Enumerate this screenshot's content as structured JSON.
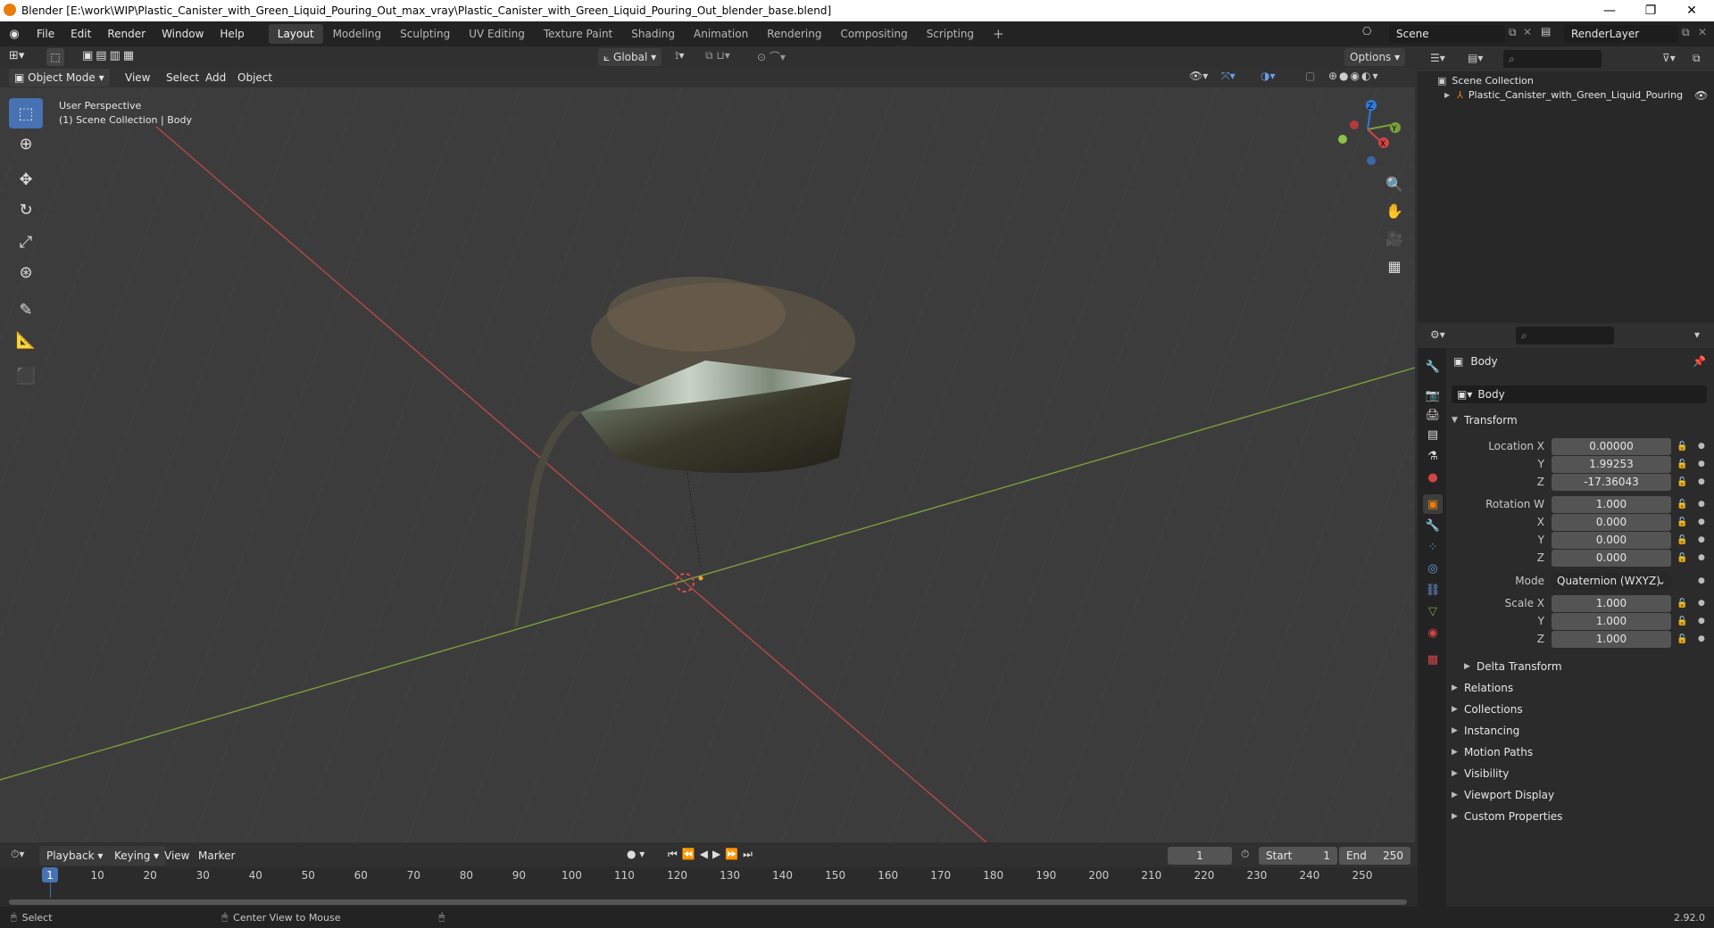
{
  "window": {
    "title": "Blender [E:\\work\\WIP\\Plastic_Canister_with_Green_Liquid_Pouring_Out_max_vray\\Plastic_Canister_with_Green_Liquid_Pouring_Out_blender_base.blend]",
    "minimize": "—",
    "restore": "❐",
    "close": "✕"
  },
  "menu": [
    "File",
    "Edit",
    "Render",
    "Window",
    "Help"
  ],
  "workspaces": [
    "Layout",
    "Modeling",
    "Sculpting",
    "UV Editing",
    "Texture Paint",
    "Shading",
    "Animation",
    "Rendering",
    "Compositing",
    "Scripting"
  ],
  "active_workspace": "Layout",
  "add_workspace": "+",
  "scene": {
    "label": "Scene",
    "render_layer": "RenderLayer"
  },
  "viewport": {
    "mode": "Object Mode",
    "menus": [
      "View",
      "Select",
      "Add",
      "Object"
    ],
    "transform_orientation": "Global",
    "options": "Options",
    "overlay_line1": "User Perspective",
    "overlay_line2": "(1) Scene Collection | Body",
    "gizmo": {
      "x": "X",
      "y": "Y",
      "z": "Z"
    }
  },
  "outliner": {
    "root": "Scene Collection",
    "items": [
      "Plastic_Canister_with_Green_Liquid_Pouring"
    ]
  },
  "properties": {
    "object_name": "Body",
    "datablock": "Body",
    "transform_label": "Transform",
    "location": {
      "label_x": "Location X",
      "label_y": "Y",
      "label_z": "Z",
      "x": "0.00000",
      "y": "1.99253",
      "z": "-17.36043"
    },
    "rotation": {
      "label_w": "Rotation W",
      "label_x": "X",
      "label_y": "Y",
      "label_z": "Z",
      "w": "1.000",
      "x": "0.000",
      "y": "0.000",
      "z": "0.000"
    },
    "mode": {
      "label": "Mode",
      "value": "Quaternion (WXYZ)"
    },
    "scale": {
      "label_x": "Scale X",
      "label_y": "Y",
      "label_z": "Z",
      "x": "1.000",
      "y": "1.000",
      "z": "1.000"
    },
    "delta_transform": "Delta Transform",
    "panels": [
      "Relations",
      "Collections",
      "Instancing",
      "Motion Paths",
      "Visibility",
      "Viewport Display",
      "Custom Properties"
    ]
  },
  "timeline": {
    "menus": [
      "Playback",
      "Keying",
      "View",
      "Marker"
    ],
    "current_frame": "1",
    "start_label": "Start",
    "start": "1",
    "end_label": "End",
    "end": "250",
    "ticks": [
      "1",
      "10",
      "20",
      "30",
      "40",
      "50",
      "60",
      "70",
      "80",
      "90",
      "100",
      "110",
      "120",
      "130",
      "140",
      "150",
      "160",
      "170",
      "180",
      "190",
      "200",
      "210",
      "220",
      "230",
      "240",
      "250"
    ]
  },
  "status": {
    "select": "Select",
    "center_view": "Center View to Mouse",
    "version": "2.92.0"
  },
  "colors": {
    "accent": "#4772b3",
    "x_axis": "#d04545",
    "y_axis": "#7aa03a",
    "z_axis": "#2f7bd9"
  }
}
